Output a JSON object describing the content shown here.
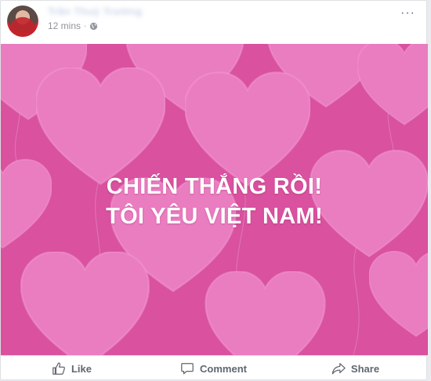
{
  "post": {
    "author_name": "Trần Thuỳ Trường",
    "timestamp": "12 mins",
    "separator": "·",
    "privacy_icon": "globe-icon",
    "more_icon": "more-options-icon"
  },
  "image": {
    "line1": "CHIẾN THẮNG RỒI!",
    "line2": "TÔI YÊU VIỆT NAM!",
    "background_color": "#d9519f",
    "heart_color": "#ea7cc0"
  },
  "actions": {
    "like": "Like",
    "comment": "Comment",
    "share": "Share"
  }
}
